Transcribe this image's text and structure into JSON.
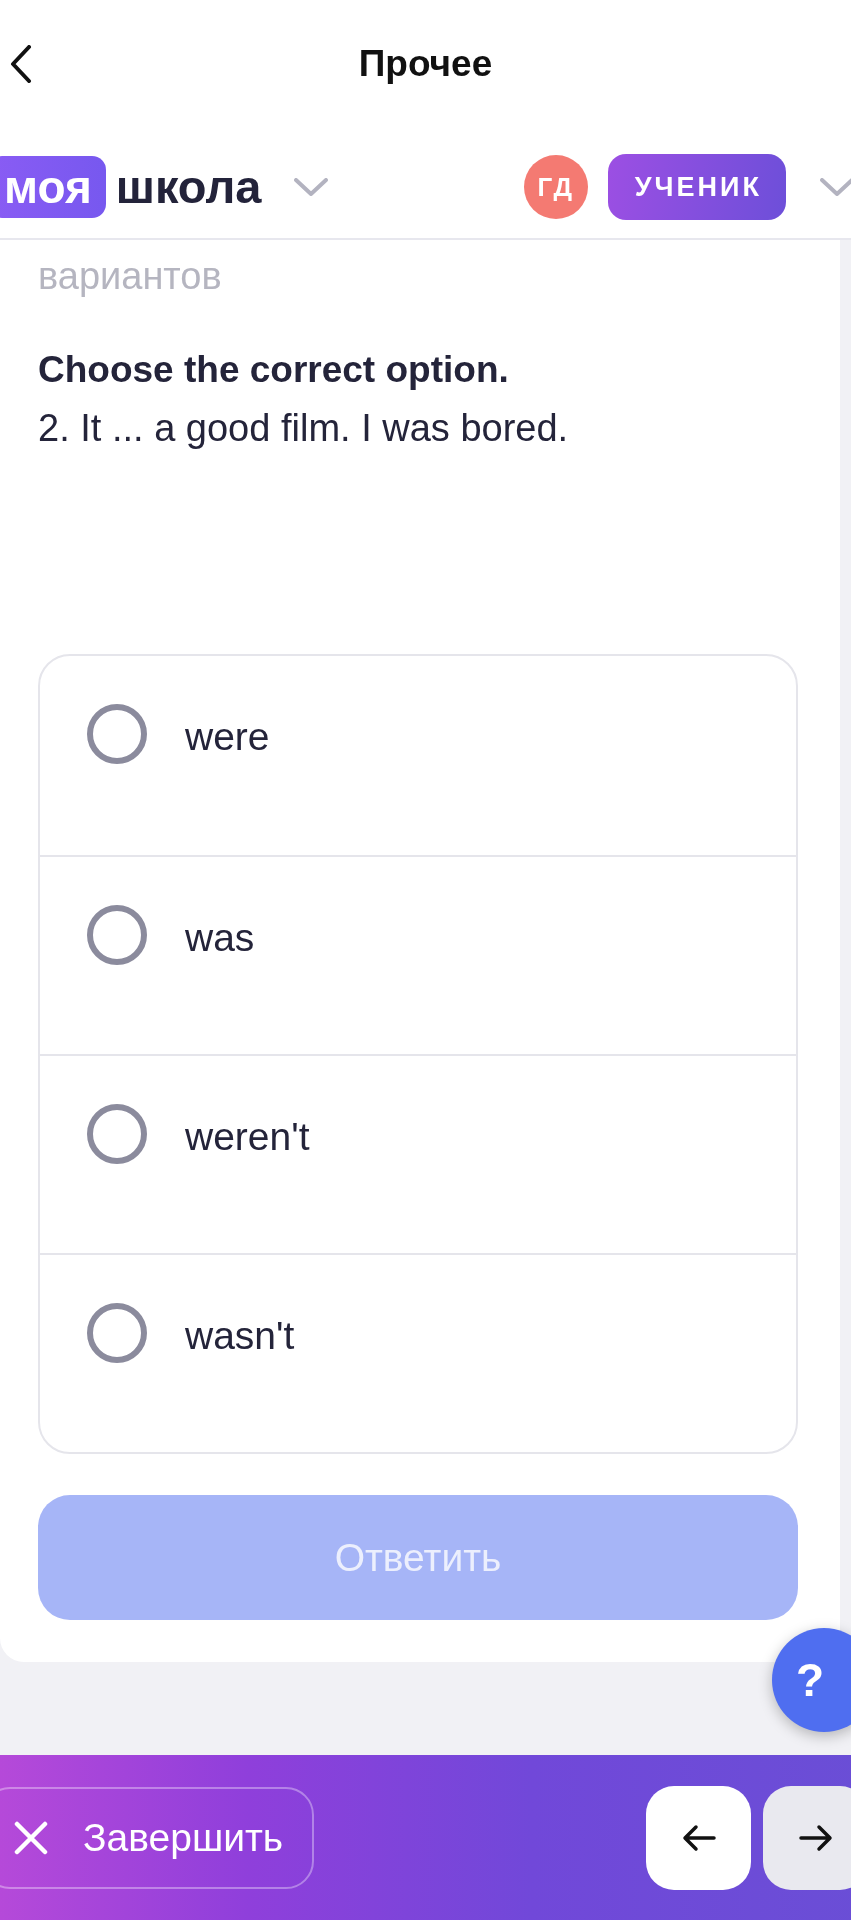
{
  "top_bar": {
    "title": "Прочее"
  },
  "school_header": {
    "logo_badge": "моя",
    "logo_word": "школа",
    "avatar_initials": "ГД",
    "role": "УЧЕНИК"
  },
  "task": {
    "text_fragment": "вариантов",
    "instruction": "Choose the correct option.",
    "question": "2. It ... a good film. I was bored."
  },
  "options": [
    {
      "label": "were",
      "selected": false
    },
    {
      "label": "was",
      "selected": false
    },
    {
      "label": "weren't",
      "selected": false
    },
    {
      "label": "wasn't",
      "selected": false
    }
  ],
  "answer_button": {
    "label": "Ответить",
    "disabled": true
  },
  "help_button": {
    "label": "?"
  },
  "bottom_bar": {
    "finish_button": {
      "label": "Завершить"
    },
    "nav_buttons": [
      {
        "kind": "previous",
        "disabled": false
      },
      {
        "kind": "next",
        "disabled": true
      }
    ]
  }
}
